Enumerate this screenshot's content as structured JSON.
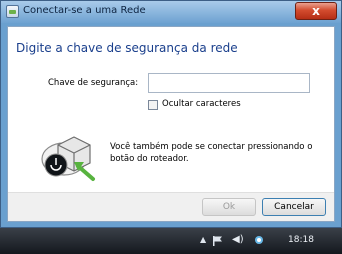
{
  "window": {
    "title": "Conectar-se a uma Rede",
    "close_label": "x"
  },
  "dialog": {
    "heading": "Digite a chave de segurança da rede",
    "key_label": "Chave de segurança:",
    "key_value": "",
    "hide_chars_label": "Ocultar caracteres",
    "router_text": "Você também pode se conectar pressionando o botão do roteador."
  },
  "buttons": {
    "ok_label": "Ok",
    "cancel_label": "Cancelar"
  },
  "taskbar": {
    "clock": "18:18",
    "tray_arrow": "▲",
    "speaker_glyph": "◀)"
  },
  "icons": [
    "app-icon",
    "close-icon",
    "router-icon",
    "show-hidden-icons",
    "action-center-flag-icon",
    "speaker-icon",
    "network-icon"
  ]
}
